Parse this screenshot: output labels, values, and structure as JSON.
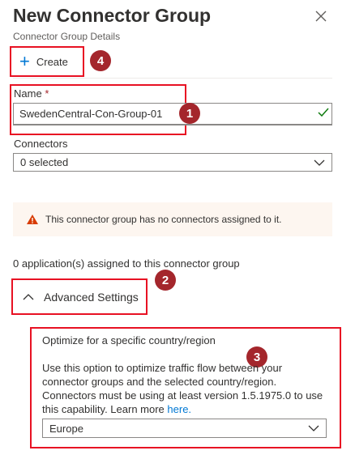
{
  "header": {
    "title": "New Connector Group",
    "subtitle": "Connector Group Details"
  },
  "toolbar": {
    "create_label": "Create"
  },
  "form": {
    "name_label": "Name",
    "name_required_mark": "*",
    "name_value": "SwedenCentral-Con-Group-01",
    "connectors_label": "Connectors",
    "connectors_value": "0 selected"
  },
  "warning": {
    "text": "This connector group has no connectors assigned to it."
  },
  "applications_text": "0 application(s) assigned to this connector group",
  "advanced": {
    "label": "Advanced Settings"
  },
  "optimize": {
    "title": "Optimize for a specific country/region",
    "description": "Use this option to optimize traffic flow between your connector groups and the selected country/region. Connectors must be using at least version 1.5.1975.0 to use this capability. Learn more",
    "link": "here.",
    "region_value": "Europe"
  },
  "callouts": {
    "one": "1",
    "two": "2",
    "three": "3",
    "four": "4"
  },
  "colors": {
    "accent": "#0078d4",
    "highlight_border": "#e81123",
    "callout": "#a4262c",
    "warning_icon": "#d83b01",
    "valid_check": "#107c10"
  },
  "icons": [
    "close-icon",
    "plus-icon",
    "checkmark-icon",
    "chevron-down-icon",
    "warning-icon",
    "chevron-up-icon"
  ]
}
